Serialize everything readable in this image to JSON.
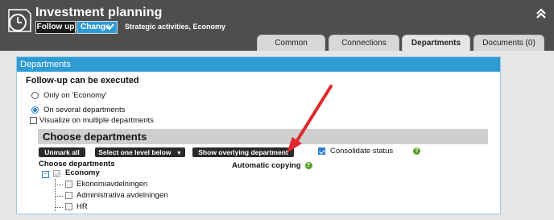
{
  "header": {
    "title": "Investment planning",
    "followup_label": "Follow up",
    "change_label": "Change",
    "subtitle": "Strategic activities, Economy"
  },
  "tabs": [
    {
      "label": "Common"
    },
    {
      "label": "Connections"
    },
    {
      "label": "Departments",
      "active": true
    },
    {
      "label": "Documents (0)"
    }
  ],
  "panel": {
    "header": "Departments",
    "followup_title": "Follow-up can be executed",
    "radio_only": "Only on 'Economy'",
    "radio_several": "On several departments",
    "visualize_label": "Visualize on multiple departments",
    "choose_title": "Choose departments",
    "buttons": {
      "unmark_all": "Unmark all",
      "select_one_level": "Select one level below",
      "show_overlying": "Show overlying department"
    },
    "consolidate_label": "Consolidate status",
    "choose_label": "Choose departments",
    "auto_copy_label": "Automatic copying",
    "help_glyph": "?",
    "tree": {
      "root": "Economy",
      "children": [
        "Ekonomiavdelningen",
        "Administrativa avdelningen",
        "HR"
      ]
    }
  },
  "colors": {
    "header_bg": "#4e4e4e",
    "accent_blue": "#2f9bd3",
    "help_green": "#5aa02c",
    "arrow_red": "#e0282e"
  }
}
